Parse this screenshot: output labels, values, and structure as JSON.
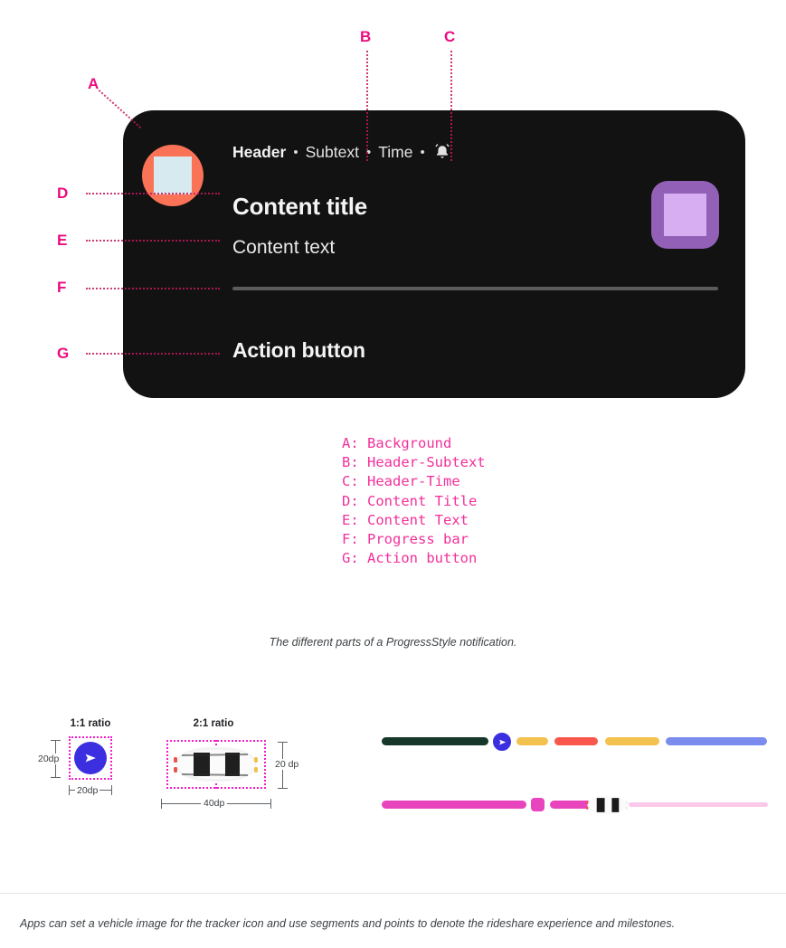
{
  "callouts": [
    {
      "id": "A",
      "label": "A"
    },
    {
      "id": "B",
      "label": "B"
    },
    {
      "id": "C",
      "label": "C"
    },
    {
      "id": "D",
      "label": "D"
    },
    {
      "id": "E",
      "label": "E"
    },
    {
      "id": "F",
      "label": "F"
    },
    {
      "id": "G",
      "label": "G"
    }
  ],
  "notification": {
    "header": "Header",
    "separator_1": "•",
    "subtext": "Subtext",
    "separator_2": "•",
    "time": "Time",
    "separator_3": "•",
    "bell_icon": "bell-icon",
    "content_title": "Content title",
    "content_text": "Content text",
    "action_button": "Action button",
    "avatar_icon": "avatar-blob-icon",
    "large_icon": "large-purple-icon",
    "colors": {
      "background": "#121212",
      "avatar": "#FB7357",
      "avatar_blob": "#D7EAEF",
      "large_icon": "#9360B8",
      "large_icon_blob": "#D7AEF2",
      "progress_track": "#5C5C5C",
      "title_text": "#F4F4F4"
    }
  },
  "legend": {
    "accent_color": "#F2309B",
    "lines": [
      "A: Background",
      "B: Header-Subtext",
      "C: Header-Time",
      "D: Content Title",
      "E: Content Text",
      "F: Progress bar",
      "G: Action button"
    ],
    "text": "A: Background\nB: Header-Subtext\nC: Header-Time\nD: Content Title\nE: Content Text\nF: Progress bar\nG: Action button"
  },
  "captions": {
    "middle": "The different parts of a ProgressStyle notification.",
    "bottom": "Apps can set a vehicle image for the tracker icon and use segments and points to denote the rideshare experience and milestones."
  },
  "specimens": {
    "one_to_one": {
      "ratio_label": "1:1 ratio",
      "height_label": "20dp",
      "width_label": "20dp",
      "icon": "play-navigation-icon",
      "icon_color": "#3B2FE0"
    },
    "two_to_one": {
      "ratio_label": "2:1 ratio",
      "height_label": "20 dp",
      "width_label": "40dp",
      "icon": "car-top-view-icon"
    },
    "guide_color": "#F41BC9"
  },
  "progress_demos": [
    {
      "name": "segmented-multicolor-bar",
      "tracker_icon": "play-navigation-icon",
      "tracker_color": "#3B2FE0",
      "segments": [
        {
          "color": "#17372B",
          "label": "completed"
        },
        {
          "color": "#F2C14E",
          "label": "segment-yellow-1"
        },
        {
          "color": "#F9574C",
          "label": "segment-red"
        },
        {
          "color": "#F2C14E",
          "label": "segment-yellow-2"
        },
        {
          "color": "#7C8CEE",
          "label": "segment-blue"
        }
      ]
    },
    {
      "name": "rideshare-magenta-bar",
      "tracker_icon": "car-top-view-icon",
      "fill_color": "#E844BE",
      "track_color": "#FBC8EA",
      "point_color": "#E844BE",
      "point_label": "milestone-point"
    }
  ]
}
